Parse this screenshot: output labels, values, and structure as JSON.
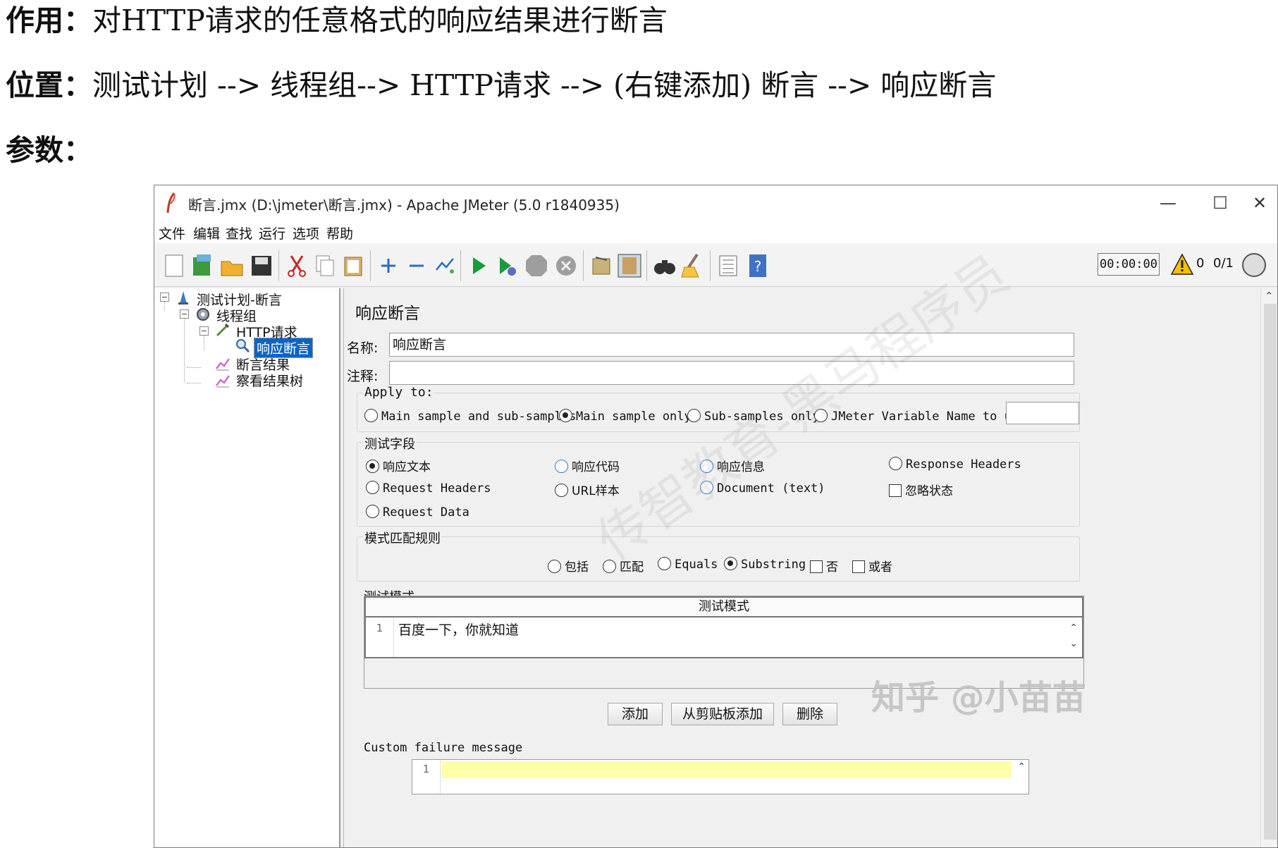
{
  "doc": {
    "purpose_label": "作用：",
    "purpose_text": "对HTTP请求的任意格式的响应结果进行断言",
    "location_label": "位置：",
    "location_text": "测试计划 --> 线程组--> HTTP请求 --> (右键添加) 断言 --> 响应断言",
    "params_label": "参数："
  },
  "window": {
    "title": "断言.jmx (D:\\jmeter\\断言.jmx) - Apache JMeter (5.0 r1840935)",
    "minimize": "—",
    "maximize": "☐",
    "close": "✕"
  },
  "menu": [
    "文件",
    "编辑",
    "查找",
    "运行",
    "选项",
    "帮助"
  ],
  "toolbar": {
    "timer": "00:00:00",
    "warnings": "0",
    "threads": "0/1"
  },
  "tree": {
    "plan": "测试计划-断言",
    "thread_group": "线程组",
    "http_request": "HTTP请求",
    "assertion": "响应断言",
    "assertion_results": "断言结果",
    "results_tree": "察看结果树"
  },
  "panel": {
    "title": "响应断言",
    "name_label": "名称:",
    "name_value": "响应断言",
    "comment_label": "注释:",
    "apply_to": {
      "title": "Apply to:",
      "options": [
        "Main sample and sub-samples",
        "Main sample only",
        "Sub-samples only",
        "JMeter Variable Name to use"
      ],
      "selected": "Main sample only"
    },
    "test_field": {
      "title": "测试字段",
      "options": [
        "响应文本",
        "响应代码",
        "响应信息",
        "Response Headers",
        "Request Headers",
        "URL样本",
        "Document (text)",
        "忽略状态",
        "Request Data"
      ],
      "selected": "响应文本"
    },
    "pattern_rules": {
      "title": "模式匹配规则",
      "options": [
        "包括",
        "匹配",
        "Equals",
        "Substring",
        "否",
        "或者"
      ],
      "selected": "Substring"
    },
    "patterns": {
      "title": "测试模式",
      "column": "测试模式",
      "rows": [
        {
          "line": "1",
          "value": "百度一下，你就知道"
        }
      ]
    },
    "buttons": {
      "add": "添加",
      "add_clipboard": "从剪贴板添加",
      "delete": "删除"
    },
    "failure": {
      "title": "Custom failure message",
      "line": "1"
    }
  },
  "watermark": "传智教育-黑马程序员",
  "credit": "知乎 @小苗苗"
}
